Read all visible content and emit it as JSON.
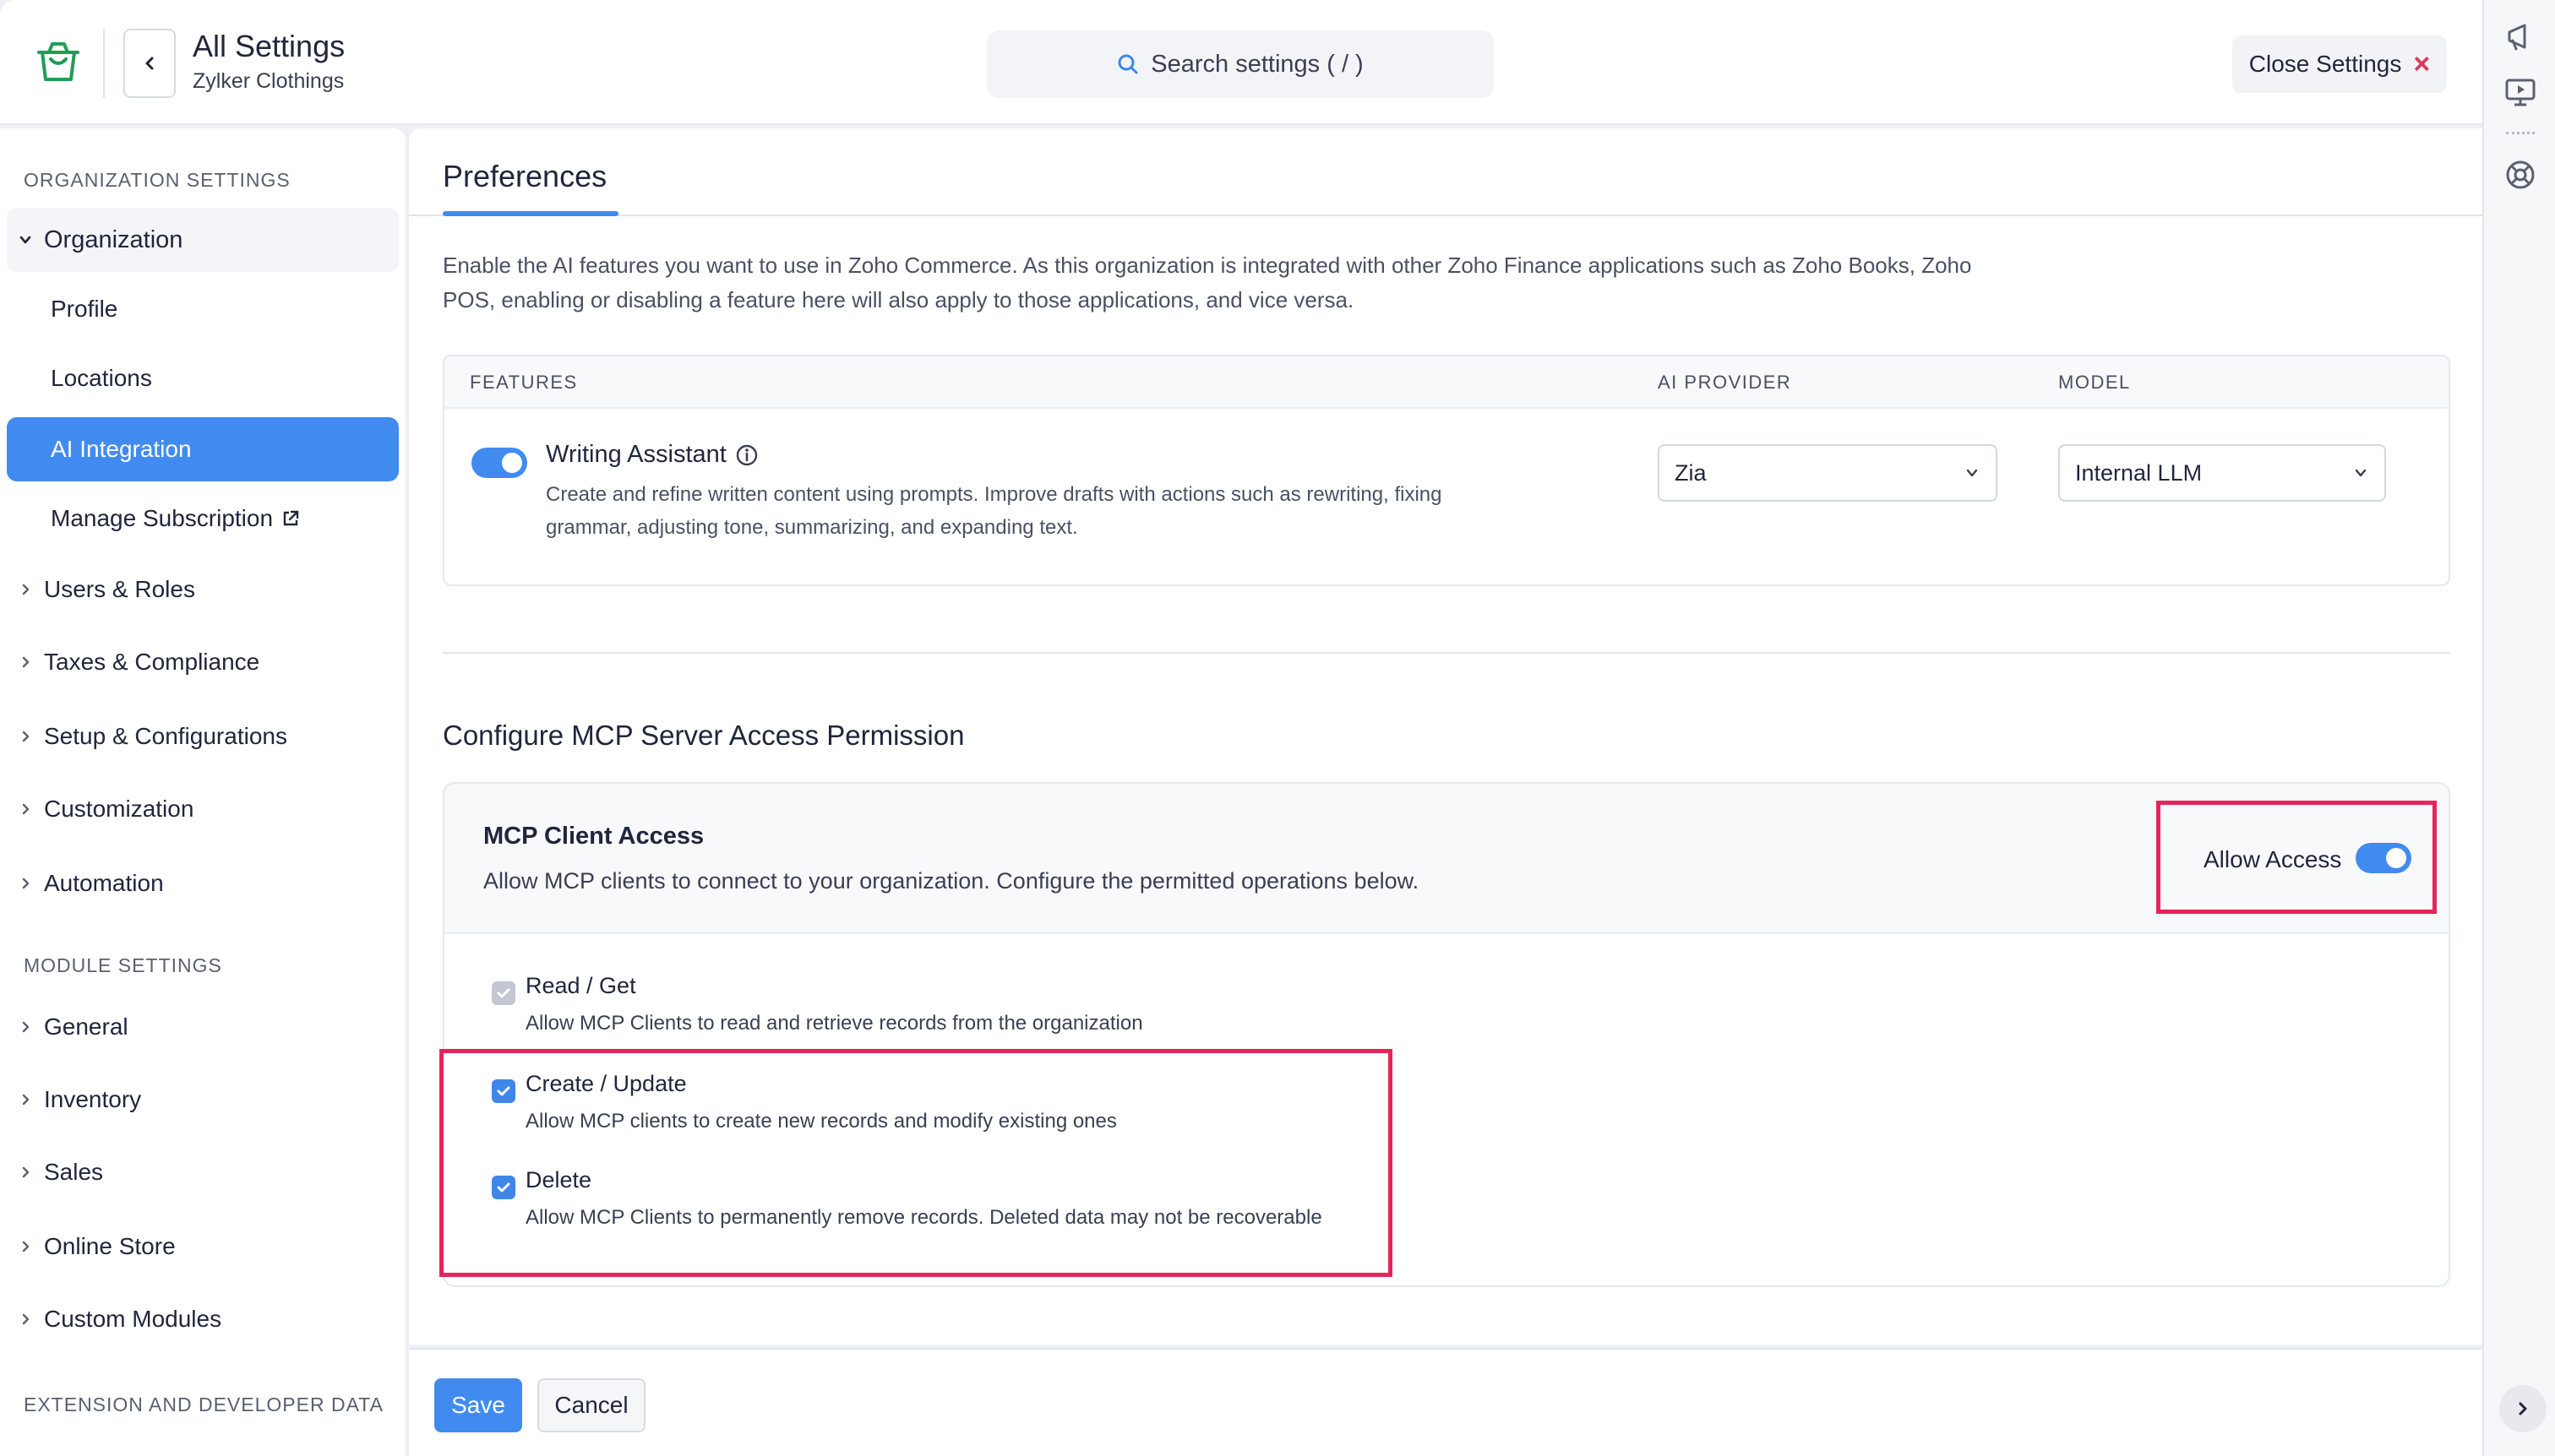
{
  "header": {
    "title": "All Settings",
    "subtitle": "Zylker Clothings",
    "search_placeholder": "Search settings ( / )",
    "close_label": "Close Settings"
  },
  "sidebar": {
    "org_heading": "ORGANIZATION SETTINGS",
    "org_item": "Organization",
    "org_sub_items": [
      "Profile",
      "Locations",
      "AI Integration",
      "Manage Subscription"
    ],
    "org_groups": [
      "Users & Roles",
      "Taxes & Compliance",
      "Setup & Configurations",
      "Customization",
      "Automation"
    ],
    "module_heading": "MODULE SETTINGS",
    "module_items": [
      "General",
      "Inventory",
      "Sales",
      "Online Store",
      "Custom Modules"
    ],
    "ext_heading": "EXTENSION AND DEVELOPER DATA",
    "active_item": "AI Integration"
  },
  "main": {
    "tab": "Preferences",
    "intro": "Enable the AI features you want to use in Zoho Commerce. As this organization is integrated with other Zoho Finance applications such as Zoho Books, Zoho POS, enabling or disabling a feature here will also apply to those applications, and vice versa.",
    "table": {
      "col_features": "FEATURES",
      "col_provider": "AI PROVIDER",
      "col_model": "MODEL",
      "feature_title": "Writing Assistant",
      "feature_desc": "Create and refine written content using prompts. Improve drafts with actions such as rewriting, fixing grammar, adjusting tone, summarizing, and expanding text.",
      "feature_enabled": true,
      "provider": "Zia",
      "model": "Internal LLM"
    },
    "mcp": {
      "section_title": "Configure MCP Server Access Permission",
      "client_title": "MCP Client Access",
      "client_desc": "Allow MCP clients to connect to your organization. Configure the permitted operations below.",
      "allow_label": "Allow Access",
      "allow_enabled": true,
      "permissions": [
        {
          "title": "Read / Get",
          "desc": "Allow MCP Clients to read and retrieve records from the organization",
          "checked": true,
          "disabled": true
        },
        {
          "title": "Create / Update",
          "desc": "Allow MCP clients to create new records and modify existing ones",
          "checked": true,
          "disabled": false
        },
        {
          "title": "Delete",
          "desc": "Allow MCP Clients to permanently remove records. Deleted data may not be recoverable",
          "checked": true,
          "disabled": false
        }
      ]
    }
  },
  "footer": {
    "save_label": "Save",
    "cancel_label": "Cancel"
  },
  "colors": {
    "accent": "#418bf0",
    "highlight": "#e5255a",
    "logo_green": "#1f9d55"
  }
}
